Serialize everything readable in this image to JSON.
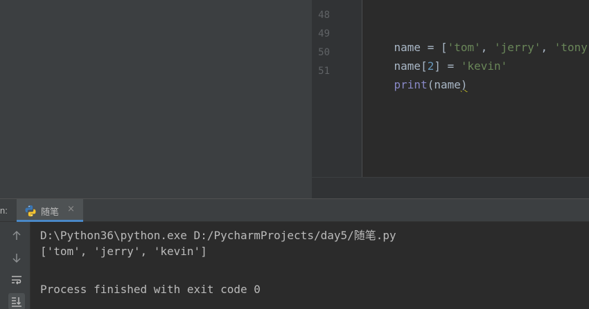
{
  "editor": {
    "lines": [
      {
        "num": "48",
        "code": ""
      },
      {
        "num": "49",
        "code": "name = ['tom', 'jerry', 'tony']"
      },
      {
        "num": "50",
        "code": "name[2] = 'kevin'"
      },
      {
        "num": "51",
        "code": "print(name)"
      }
    ],
    "line49": {
      "a": "name = [",
      "s1": "'tom'",
      "c1": ", ",
      "s2": "'jerry'",
      "c2": ", ",
      "s3": "'tony'",
      "e": "]"
    },
    "line50": {
      "a": "name[",
      "n": "2",
      "b": "] = ",
      "s": "'kevin'"
    },
    "line51": {
      "fn": "print",
      "a": "(name",
      "e": ")"
    }
  },
  "run": {
    "label": "n:",
    "tab_label": "随笔",
    "tab_close": "×",
    "tab_icon": "python-icon"
  },
  "console": {
    "lines": [
      "D:\\Python36\\python.exe D:/PycharmProjects/day5/随笔.py",
      "['tom', 'jerry', 'kevin']",
      "",
      "Process finished with exit code 0"
    ]
  },
  "toolbar": {
    "icons": [
      "arrow-up-icon",
      "arrow-down-icon",
      "soft-wrap-icon",
      "scroll-to-end-icon"
    ]
  },
  "colors": {
    "string": "#6a8759",
    "number": "#6897bb",
    "builtin": "#8888c6",
    "text": "#a9b7c6",
    "tab_underline": "#4a88c7"
  }
}
